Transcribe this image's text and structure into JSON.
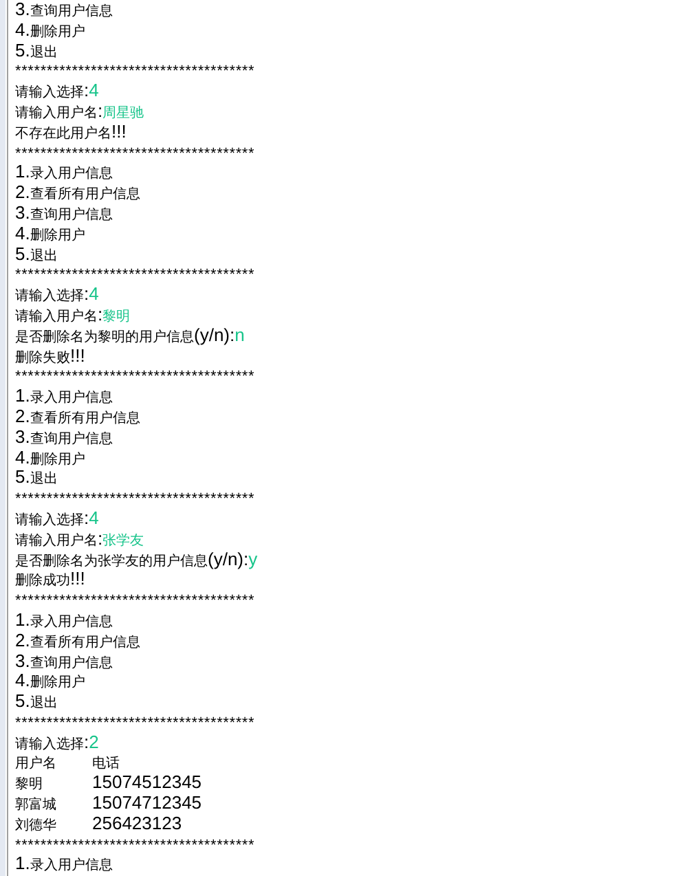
{
  "console_lines": [
    {
      "kind": "menu",
      "text": "3.查询用户信息"
    },
    {
      "kind": "menu",
      "text": "4.删除用户"
    },
    {
      "kind": "menu",
      "text": "5.退出"
    },
    {
      "kind": "separator",
      "text": "**************************************"
    },
    {
      "kind": "prompt",
      "text": "请输入选择:",
      "input": "4"
    },
    {
      "kind": "prompt",
      "text": "请输入用户名:",
      "input": "周星驰"
    },
    {
      "kind": "message",
      "text": "不存在此用户名!!!"
    },
    {
      "kind": "separator",
      "text": "**************************************"
    },
    {
      "kind": "menu",
      "text": "1.录入用户信息"
    },
    {
      "kind": "menu",
      "text": "2.查看所有用户信息"
    },
    {
      "kind": "menu",
      "text": "3.查询用户信息"
    },
    {
      "kind": "menu",
      "text": "4.删除用户"
    },
    {
      "kind": "menu",
      "text": "5.退出"
    },
    {
      "kind": "separator",
      "text": "**************************************"
    },
    {
      "kind": "prompt",
      "text": "请输入选择:",
      "input": "4"
    },
    {
      "kind": "prompt",
      "text": "请输入用户名:",
      "input": "黎明"
    },
    {
      "kind": "prompt",
      "text": "是否删除名为黎明的用户信息(y/n):",
      "input": "n"
    },
    {
      "kind": "message",
      "text": "删除失败!!!"
    },
    {
      "kind": "separator",
      "text": "**************************************"
    },
    {
      "kind": "menu",
      "text": "1.录入用户信息"
    },
    {
      "kind": "menu",
      "text": "2.查看所有用户信息"
    },
    {
      "kind": "menu",
      "text": "3.查询用户信息"
    },
    {
      "kind": "menu",
      "text": "4.删除用户"
    },
    {
      "kind": "menu",
      "text": "5.退出"
    },
    {
      "kind": "separator",
      "text": "**************************************"
    },
    {
      "kind": "prompt",
      "text": "请输入选择:",
      "input": "4"
    },
    {
      "kind": "prompt",
      "text": "请输入用户名:",
      "input": "张学友"
    },
    {
      "kind": "prompt",
      "text": "是否删除名为张学友的用户信息(y/n):",
      "input": "y"
    },
    {
      "kind": "message",
      "text": "删除成功!!!"
    },
    {
      "kind": "separator",
      "text": "**************************************"
    },
    {
      "kind": "menu",
      "text": "1.录入用户信息"
    },
    {
      "kind": "menu",
      "text": "2.查看所有用户信息"
    },
    {
      "kind": "menu",
      "text": "3.查询用户信息"
    },
    {
      "kind": "menu",
      "text": "4.删除用户"
    },
    {
      "kind": "menu",
      "text": "5.退出"
    },
    {
      "kind": "separator",
      "text": "**************************************"
    },
    {
      "kind": "prompt",
      "text": "请输入选择:",
      "input": "2"
    },
    {
      "kind": "table_row",
      "cells": [
        "用户名",
        "电话"
      ]
    },
    {
      "kind": "table_row",
      "cells": [
        "黎明",
        "15074512345"
      ]
    },
    {
      "kind": "table_row",
      "cells": [
        "郭富城",
        "15074712345"
      ]
    },
    {
      "kind": "table_row",
      "cells": [
        "刘德华",
        "256423123"
      ]
    },
    {
      "kind": "separator",
      "text": "**************************************"
    },
    {
      "kind": "menu",
      "text": "1.录入用户信息"
    }
  ]
}
